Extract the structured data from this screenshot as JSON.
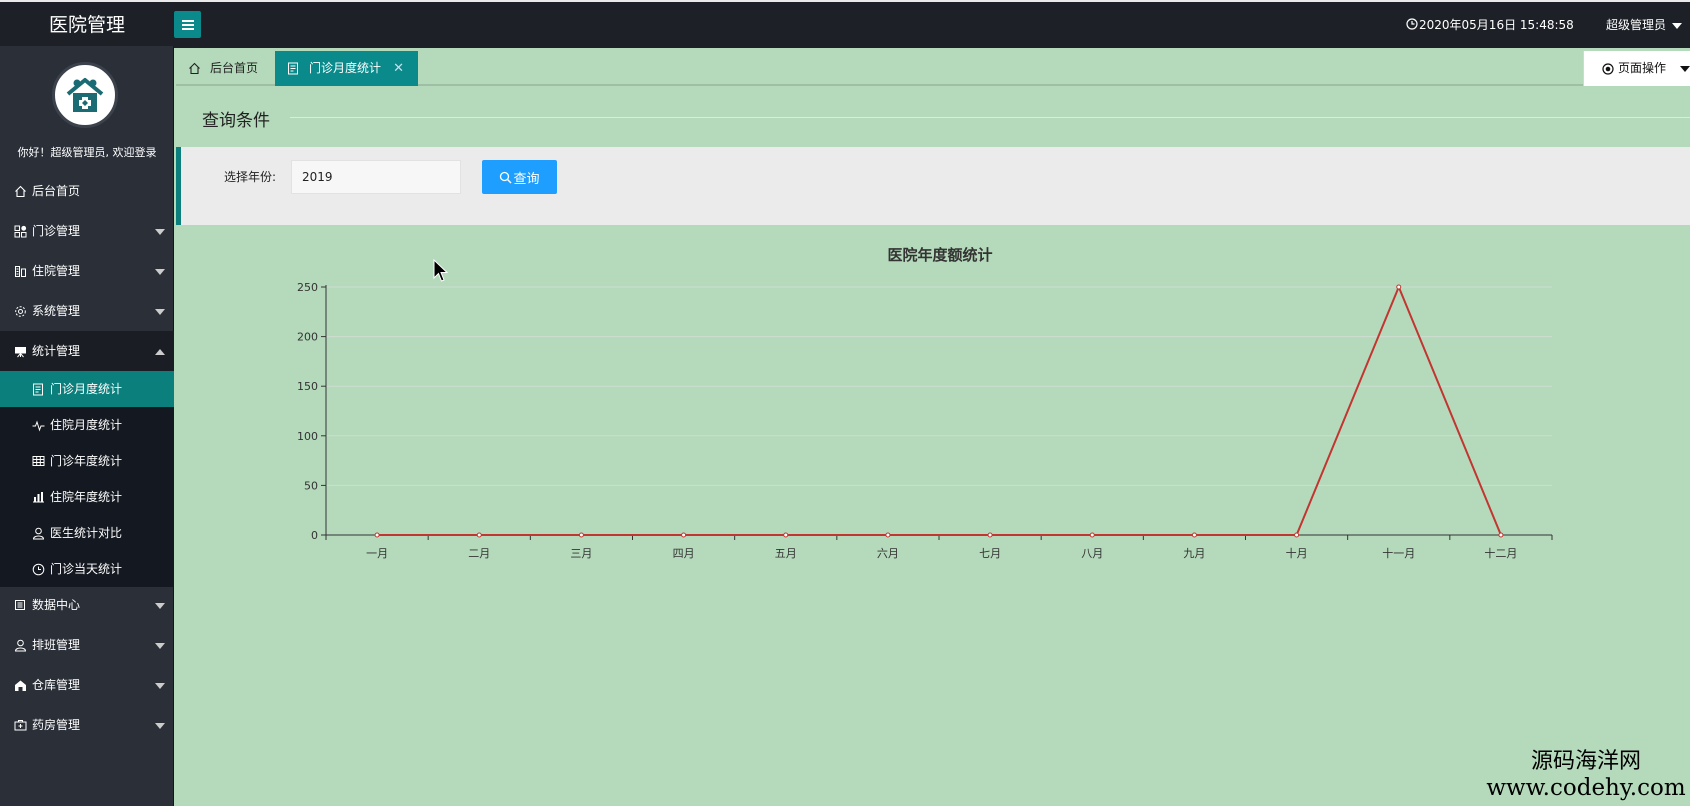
{
  "header": {
    "brand": "医院管理",
    "datetime": "2020年05月16日 15:48:58",
    "user": "超级管理员"
  },
  "sidebar": {
    "welcome": "你好！超级管理员, 欢迎登录",
    "items": [
      {
        "label": "后台首页",
        "icon": "home-icon"
      },
      {
        "label": "门诊管理",
        "icon": "grid-icon"
      },
      {
        "label": "住院管理",
        "icon": "building-icon"
      },
      {
        "label": "系统管理",
        "icon": "gear-icon"
      },
      {
        "label": "统计管理",
        "icon": "presentation-icon"
      }
    ],
    "sub_items": [
      {
        "label": "门诊月度统计",
        "icon": "document-icon"
      },
      {
        "label": "住院月度统计",
        "icon": "pulse-icon"
      },
      {
        "label": "门诊年度统计",
        "icon": "table-icon"
      },
      {
        "label": "住院年度统计",
        "icon": "chart-icon"
      },
      {
        "label": "医生统计对比",
        "icon": "users-icon"
      },
      {
        "label": "门诊当天统计",
        "icon": "clock-icon"
      }
    ],
    "bottom_items": [
      {
        "label": "数据中心",
        "icon": "data-icon"
      },
      {
        "label": "排班管理",
        "icon": "user-icon"
      },
      {
        "label": "仓库管理",
        "icon": "warehouse-icon"
      },
      {
        "label": "药房管理",
        "icon": "pharmacy-icon"
      }
    ]
  },
  "tabs": [
    {
      "label": "后台首页",
      "active": false
    },
    {
      "label": "门诊月度统计",
      "active": true
    }
  ],
  "page_ops_label": "页面操作",
  "query": {
    "section_title": "查询条件",
    "year_label": "选择年份:",
    "year_value": "2019",
    "search_button": "查询"
  },
  "chart_data": {
    "type": "line",
    "title": "医院年度额统计",
    "categories": [
      "一月",
      "二月",
      "三月",
      "四月",
      "五月",
      "六月",
      "七月",
      "八月",
      "九月",
      "十月",
      "十一月",
      "十二月"
    ],
    "values": [
      0,
      0,
      0,
      0,
      0,
      0,
      0,
      0,
      0,
      0,
      250,
      0
    ],
    "ylim": [
      0,
      250
    ],
    "yticks": [
      0,
      50,
      100,
      150,
      200,
      250
    ],
    "color": "#c23531",
    "grid": true
  },
  "watermark": {
    "name": "源码海洋网",
    "url": "www.codehy.com"
  }
}
